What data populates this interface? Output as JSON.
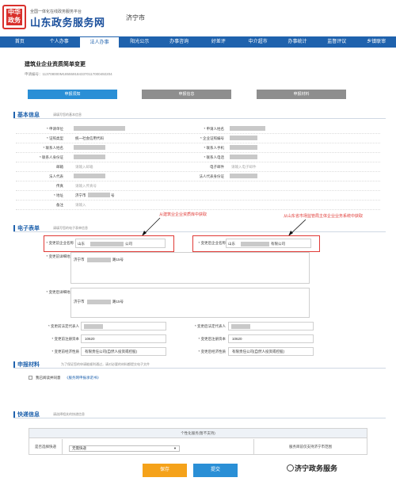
{
  "header": {
    "seal_text": "中华政务",
    "sub_title": "全国一体化在线政务服务平台",
    "site_title": "山东政务服务网",
    "city": "济宁市"
  },
  "nav": [
    "首页",
    "个人办事",
    "法人办事",
    "阳光公示",
    "办事咨询",
    "好差评",
    "中介超市",
    "办事统计",
    "监督评议",
    "乡镇联审"
  ],
  "nav_active": 2,
  "page": {
    "title": "建筑业企业资质简单变更",
    "ticket": "申请编号：113708000M1855591843370117000492204"
  },
  "steps": [
    "申报须知",
    "申报信息",
    "申报材料"
  ],
  "basic": {
    "title": "基本信息",
    "note": "请填写您的基本信息",
    "rows": [
      {
        "l1": "* 申请单位",
        "v1": "",
        "l2": "* 申请人姓名",
        "v2": ""
      },
      {
        "l1": "* 证照类型",
        "v1": "统一社会信用代码",
        "l2": "* 企业证照编号",
        "v2": ""
      },
      {
        "l1": "* 联系人姓名",
        "v1": "",
        "l2": "* 联系人手机",
        "v2": ""
      },
      {
        "l1": "* 联系人身份证",
        "v1": "",
        "l2": "* 联系人电话",
        "v2": ""
      },
      {
        "l1": "邮箱",
        "v1": "请输入邮箱",
        "l2": "电子邮件",
        "v2": "请输入电子邮件"
      },
      {
        "l1": "法人代表",
        "v1": "",
        "l2": "法人代表身份证",
        "v2": ""
      },
      {
        "l1": "传真",
        "v1": "请输入传真号",
        "l2": "",
        "v2": ""
      },
      {
        "l1": "* 地址",
        "v1": "济宁市",
        "l2": "",
        "v2": ""
      },
      {
        "l1": "备注",
        "v1": "请输入",
        "l2": "",
        "v2": ""
      }
    ],
    "addr_suffix": "号"
  },
  "eform": {
    "title": "电子表单",
    "note": "请填写您的电子表单信息",
    "red_note_left": "从建筑业企业资质库中获取",
    "red_note_right": "从山东省市场监管局主体企业业务系统中获取",
    "before_name_label": "* 变更前企业名称",
    "before_name_val": "山东",
    "after_name_label": "* 变更后企业名称",
    "after_name_val": "山东",
    "company_suffix": "公司",
    "company_suffix2": "有限公司",
    "before_addr_label": "* 变更前详细地址",
    "before_addr_val": "济宁市",
    "addr_tail": "路15号",
    "after_addr_label": "* 变更后详细地址",
    "after_addr_val": "济宁市",
    "rep_before_label": "* 变更前法定代表人",
    "rep_after_label": "* 变更后法定代表人",
    "cap_before_label": "* 变更前注册资本",
    "cap_before_val": "10620",
    "cap_after_label": "* 变更后注册资本",
    "cap_after_val": "10620",
    "type_before_label": "* 变更前经济性质",
    "type_before_val": "有限责任公司(自然人投资或控股)",
    "type_after_label": "* 变更后经济性质",
    "type_after_val": "有限责任公司(自然人投资或控股)"
  },
  "materials": {
    "title": "申报材料",
    "note": "为了保证您的申请能顺利通过，请对必要的材料都提交电子文件",
    "agree_label": "我已阅读并同意",
    "agree_link": "《服务网申报承诺书》"
  },
  "delivery": {
    "title": "快递信息",
    "note": "请选择相关的快递信息",
    "table_header": "个性化服务(暂不支持)",
    "row_label": "是否选择快递",
    "select_value": "无需快递",
    "right_text": "服务目前仅支持济宁市范围"
  },
  "buttons": {
    "save": "保存",
    "submit": "提交"
  },
  "watermark": "济宁政务服务",
  "colors": {
    "brand_blue": "#1f62ad",
    "step_active": "#2a8fd6",
    "save_orange": "#f5a21a",
    "annotation_red": "#e03a36"
  }
}
